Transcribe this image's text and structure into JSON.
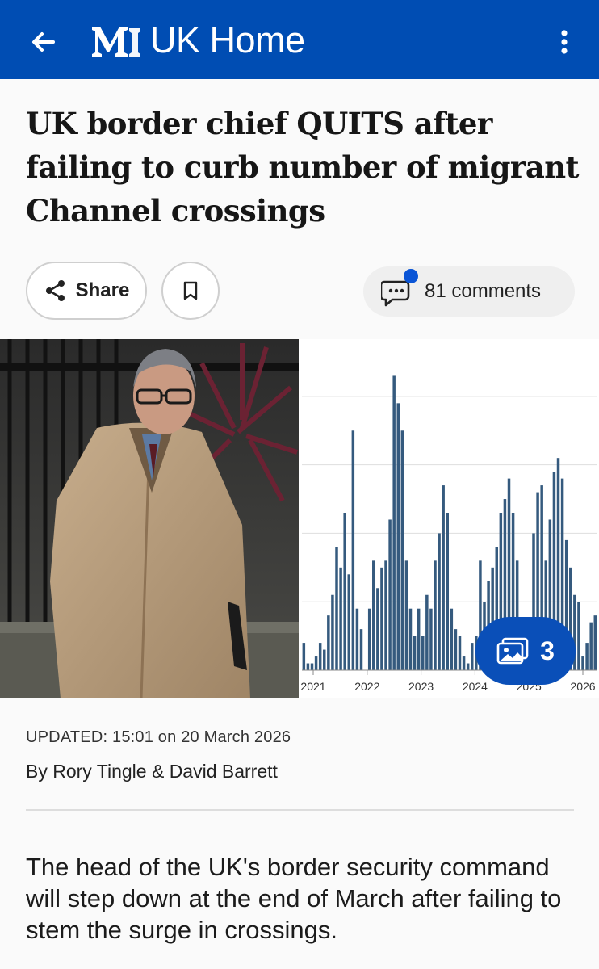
{
  "appbar": {
    "title": "UK Home",
    "logo_mark": "M",
    "back_icon": "back-arrow-icon",
    "more_icon": "more-vertical-icon",
    "background": "#004db3"
  },
  "article": {
    "headline": "UK border chief QUITS after failing to curb number of migrant Channel crossings",
    "updated": "UPDATED: 15:01 on 20 March 2026",
    "byline_prefix": "By ",
    "author_1": "Rory Tingle",
    "byline_joiner": " & ",
    "author_2": "David Barrett",
    "lead": "The head of the UK's border security command will step down at the end of March after failing to stem the surge in crossings."
  },
  "actions": {
    "share_label": "Share",
    "bookmark_icon": "bookmark-icon",
    "comments_label": "81 comments",
    "comments_icon": "comment-bubble-icon",
    "accent": "#0a55d6"
  },
  "gallery": {
    "count": "3",
    "icon": "gallery-icon",
    "color": "#0a4fb8"
  },
  "chart_data": {
    "type": "bar",
    "title": "",
    "xlabel": "",
    "ylabel": "",
    "x_ticks": [
      "2021",
      "2022",
      "2023",
      "2024",
      "2025",
      "2026"
    ],
    "grid": true,
    "bar_color": "#355a7e",
    "ylim": [
      0,
      4.6
    ],
    "values": [
      0.4,
      0.1,
      0.1,
      0.2,
      0.4,
      0.3,
      0.8,
      1.1,
      1.8,
      1.5,
      2.3,
      1.4,
      3.5,
      0.9,
      0.6,
      0,
      0.9,
      1.6,
      1.2,
      1.5,
      1.6,
      2.2,
      4.3,
      3.9,
      3.5,
      1.6,
      0.9,
      0.5,
      0.9,
      0.5,
      1.1,
      0.9,
      1.6,
      2.0,
      2.7,
      2.3,
      0.9,
      0.6,
      0.5,
      0.2,
      0.1,
      0.4,
      0.5,
      1.6,
      1.0,
      1.3,
      1.5,
      1.8,
      2.3,
      2.5,
      2.8,
      2.3,
      1.6,
      0.7,
      0.4,
      0,
      2.0,
      2.6,
      2.7,
      1.6,
      2.2,
      2.9,
      3.1,
      2.8,
      1.9,
      1.5,
      1.1,
      1.0,
      0.2,
      0.4,
      0.7,
      0.8
    ]
  }
}
